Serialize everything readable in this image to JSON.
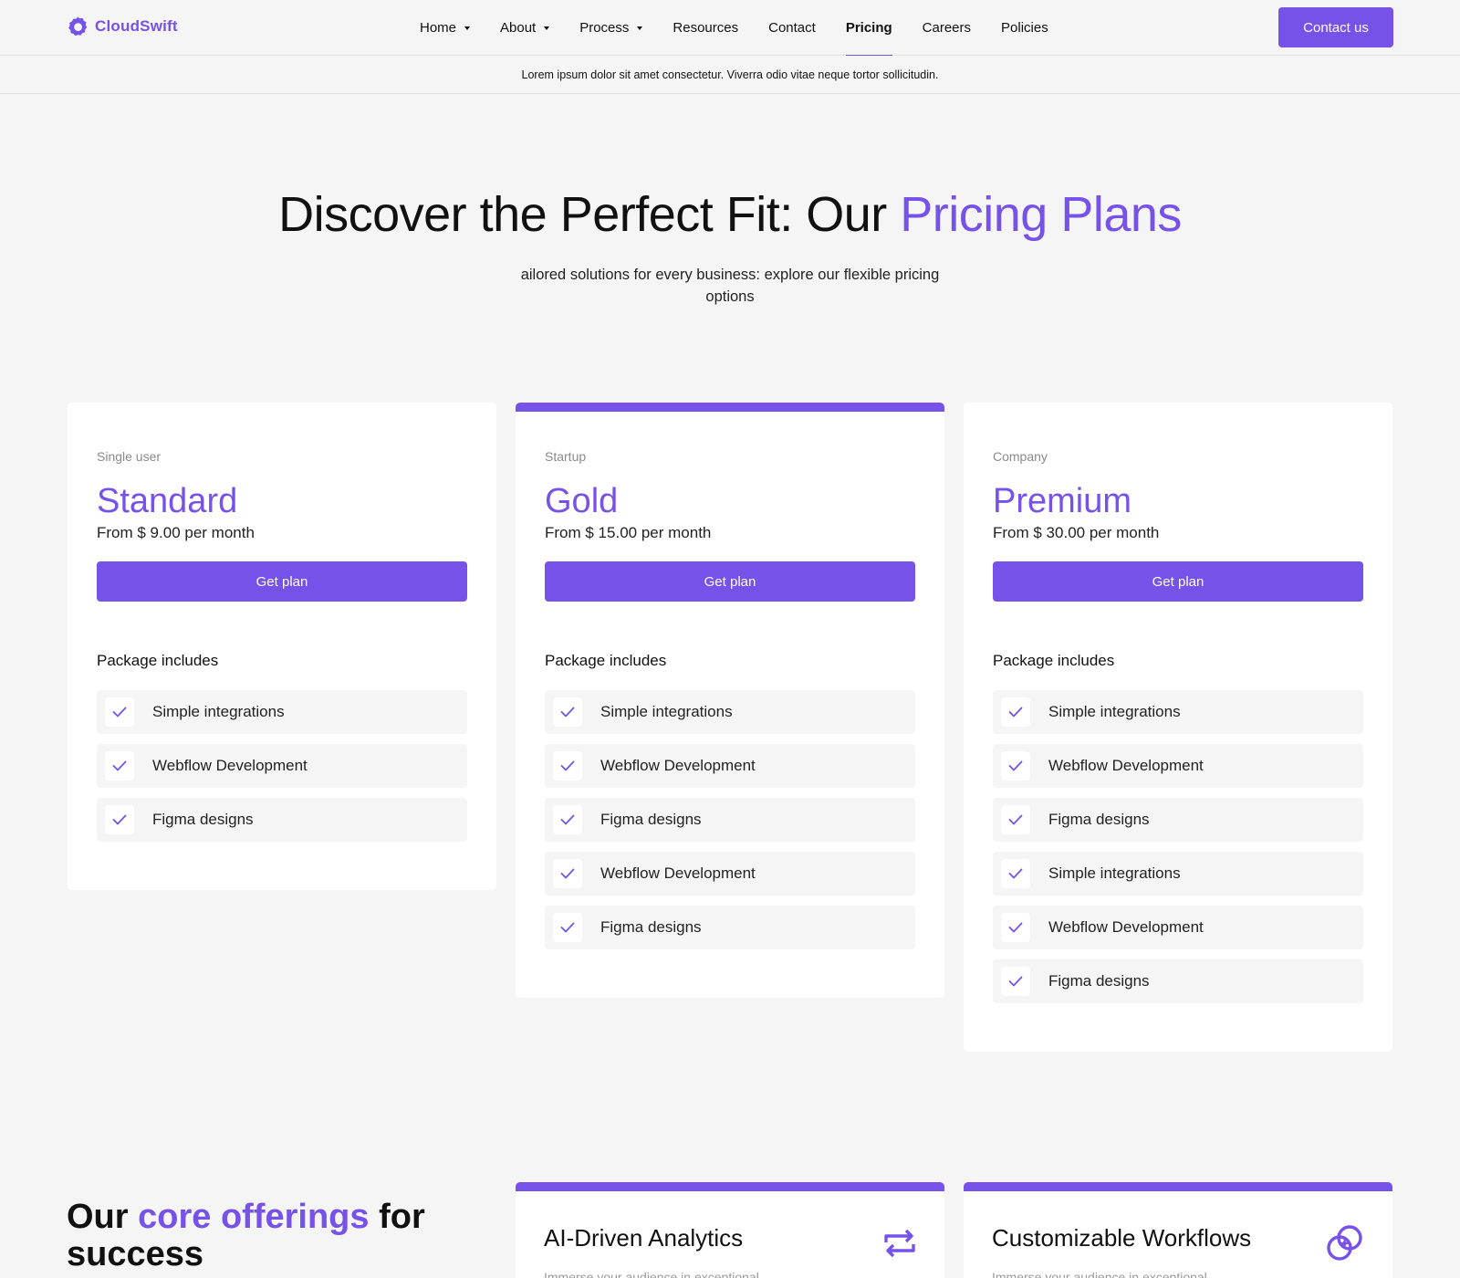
{
  "brand": {
    "name": "CloudSwift",
    "accent_color": "#7752e8"
  },
  "nav": {
    "items": [
      {
        "label": "Home",
        "has_caret": true
      },
      {
        "label": "About",
        "has_caret": true
      },
      {
        "label": "Process",
        "has_caret": true
      },
      {
        "label": "Resources",
        "has_caret": false
      },
      {
        "label": "Contact",
        "has_caret": false
      },
      {
        "label": "Pricing",
        "has_caret": false,
        "active": true
      },
      {
        "label": "Careers",
        "has_caret": false
      },
      {
        "label": "Policies",
        "has_caret": false
      }
    ],
    "cta_label": "Contact us"
  },
  "announcement": "Lorem ipsum dolor sit amet consectetur. Viverra odio vitae neque tortor sollicitudin.",
  "hero": {
    "title_prefix": "Discover the Perfect Fit: Our ",
    "title_accent": "Pricing Plans",
    "subtitle": "ailored solutions for every business: explore our flexible pricing options"
  },
  "plans": [
    {
      "eyebrow": "Single user",
      "name": "Standard",
      "price": "From $ 9.00 per month",
      "button_label": "Get plan",
      "includes_title": "Package includes",
      "featured": false,
      "features": [
        "Simple integrations",
        "Webflow Development",
        "Figma designs"
      ]
    },
    {
      "eyebrow": "Startup",
      "name": "Gold",
      "price": "From $ 15.00 per month",
      "button_label": "Get plan",
      "includes_title": "Package includes",
      "featured": true,
      "features": [
        "Simple integrations",
        "Webflow Development",
        "Figma designs",
        "Webflow Development",
        "Figma designs"
      ]
    },
    {
      "eyebrow": "Company",
      "name": "Premium",
      "price": "From $ 30.00 per month",
      "button_label": "Get plan",
      "includes_title": "Package includes",
      "featured": false,
      "features": [
        "Simple integrations",
        "Webflow Development",
        "Figma designs",
        "Simple integrations",
        "Webflow Development",
        "Figma designs"
      ]
    }
  ],
  "offerings": {
    "title_prefix": "Our ",
    "title_accent": "core offerings",
    "title_suffix": " for success",
    "cards": [
      {
        "title": "AI-Driven Analytics",
        "text": "Immerse your audience in exceptional",
        "icon": "repeat-arrows-icon"
      },
      {
        "title": "Customizable Workflows",
        "text": "Immerse your audience in exceptional",
        "icon": "linked-rings-icon"
      }
    ]
  }
}
